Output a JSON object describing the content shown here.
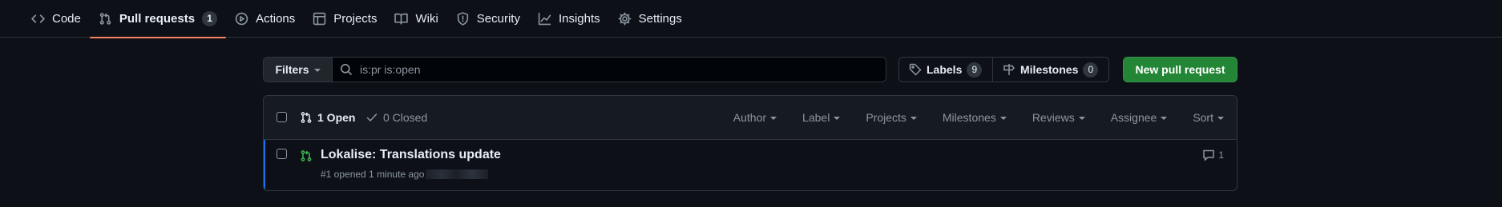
{
  "repo_nav": {
    "items": [
      {
        "label": "Code",
        "icon": "code-icon"
      },
      {
        "label": "Pull requests",
        "icon": "git-pull-request-icon",
        "count": "1",
        "selected": true
      },
      {
        "label": "Actions",
        "icon": "play-icon"
      },
      {
        "label": "Projects",
        "icon": "table-icon"
      },
      {
        "label": "Wiki",
        "icon": "book-icon"
      },
      {
        "label": "Security",
        "icon": "shield-icon"
      },
      {
        "label": "Insights",
        "icon": "graph-icon"
      },
      {
        "label": "Settings",
        "icon": "gear-icon"
      }
    ]
  },
  "toolbar": {
    "filters_label": "Filters",
    "search_value": "is:pr is:open",
    "labels_label": "Labels",
    "labels_count": "9",
    "milestones_label": "Milestones",
    "milestones_count": "0",
    "new_pr_label": "New pull request"
  },
  "list_header": {
    "open_label": "1 Open",
    "closed_label": "0 Closed",
    "sort_menus": [
      "Author",
      "Label",
      "Projects",
      "Milestones",
      "Reviews",
      "Assignee",
      "Sort"
    ]
  },
  "pull_requests": [
    {
      "title": "Lokalise: Translations update",
      "meta": "#1 opened 1 minute ago",
      "comments": "1"
    }
  ],
  "colors": {
    "background": "#0d1117",
    "accent_underline": "#f78166",
    "open_green": "#3fb950",
    "primary_button": "#238636",
    "row_highlight": "#1f6feb"
  }
}
